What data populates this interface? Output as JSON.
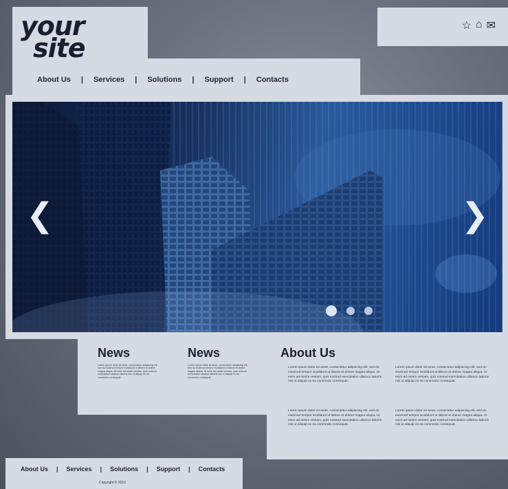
{
  "logo": {
    "line1": "your",
    "line2": "site"
  },
  "header_icons": [
    {
      "name": "star-icon",
      "glyph": "☆"
    },
    {
      "name": "home-icon",
      "glyph": "⌂"
    },
    {
      "name": "mail-icon",
      "glyph": "✉"
    }
  ],
  "nav": {
    "items": [
      "About Us",
      "Services",
      "Solutions",
      "Support",
      "Contacts"
    ],
    "separator": "|"
  },
  "slider": {
    "prev_arrow": "❮",
    "next_arrow": "❯",
    "dots": 3,
    "active_dot": 0
  },
  "news": [
    {
      "title": "News",
      "text": "Lorem ipsum dolor sit amet, consectetur adipiscing elit, sed do eiusmod tempor incididunt ut labore et dolore magna aliqua. Ut enim ad minim veniam, quis nostrud exercitation ullamco laboris nisi ut aliquip ex ea commodo consequat."
    },
    {
      "title": "News",
      "text": "Lorem ipsum dolor sit amet, consectetur adipiscing elit, sed do eiusmod tempor incididunt ut labore et dolore magna aliqua. Ut enim ad minim veniam, quis nostrud exercitation ullamco laboris nisi ut aliquip ex ea commodo consequat."
    }
  ],
  "about": {
    "title": "About Us",
    "paragraphs": [
      "Lorem ipsum dolor sit amet, consectetur adipiscing elit, sed do eiusmod tempor incididunt ut labore et dolore magna aliqua. Ut enim ad minim veniam, quis nostrud exercitation ullamco laboris nisi ut aliquip ex ea commodo consequat.",
      "Lorem ipsum dolor sit amet, consectetur adipiscing elit, sed do eiusmod tempor incididunt ut labore et dolore magna aliqua. Ut enim ad minim veniam, quis nostrud exercitation ullamco laboris nisi ut aliquip ex ea commodo consequat.",
      "Lorem ipsum dolor sit amet, consectetur adipiscing elit, sed do eiusmod tempor incididunt ut labore et dolore magna aliqua. Ut enim ad minim veniam, quis nostrud exercitation ullamco laboris nisi ut aliquip ex ea commodo consequat.",
      "Lorem ipsum dolor sit amet, consectetur adipiscing elit, sed do eiusmod tempor incididunt ut labore et dolore magna aliqua. Ut enim ad minim veniam, quis nostrud exercitation ullamco laboris nisi ut aliquip ex ea commodo consequat."
    ]
  },
  "footer": {
    "items": [
      "About Us",
      "Services",
      "Solutions",
      "Support",
      "Contacts"
    ],
    "separator": "|",
    "copyright": "Copyright © 2010"
  },
  "colors": {
    "panel": "#d6dbe3",
    "text": "#1a2230",
    "hero_blue": "#2a5a9c"
  }
}
